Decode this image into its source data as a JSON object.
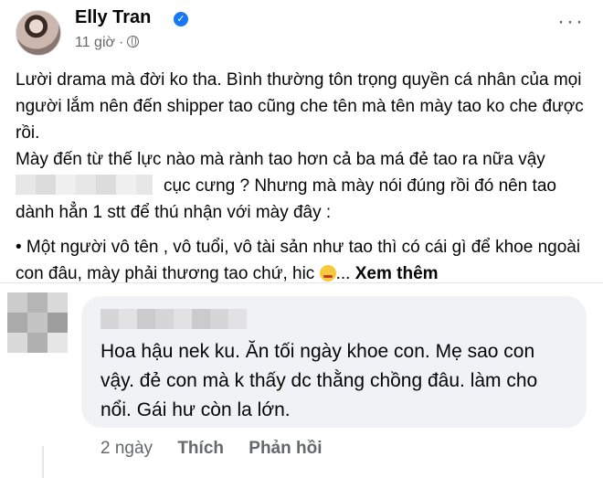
{
  "post": {
    "author": "Elly Tran",
    "verified_icon": "verified-badge-icon",
    "time": "11 giờ",
    "separator": "·",
    "privacy_icon": "globe-icon",
    "more_label": "···",
    "paragraphs": [
      "Lười drama mà đời ko tha. Bình thường tôn trọng quyền cá nhân của mọi người lắm nên đến shipper tao cũng che tên mà tên mày tao ko che được rồi.",
      "Mày đến từ thế lực nào mà rành tao hơn cả ba má đẻ tao ra nữa vậy"
    ],
    "line3_after_redacted": "cục cưng ? Nhưng mà mày nói đúng rồi đó nên tao dành hẳn 1 stt để thú nhận với mày đây :",
    "bullet": "• Một người vô tên , vô tuổi,  vô tài sản như tao thì có cái gì để khoe ngoài con đâu, mày phải thương tao chứ, hic",
    "ellipsis": "...",
    "see_more": "Xem thêm"
  },
  "comment": {
    "text": "Hoa hậu nek ku. Ăn tối ngày khoe con. Mẹ sao con vậy. đẻ con mà k thấy dc thằng chồng đâu. làm cho nổi. Gái hư còn la lớn.",
    "time": "2 ngày",
    "like_label": "Thích",
    "reply_label": "Phản hồi"
  }
}
